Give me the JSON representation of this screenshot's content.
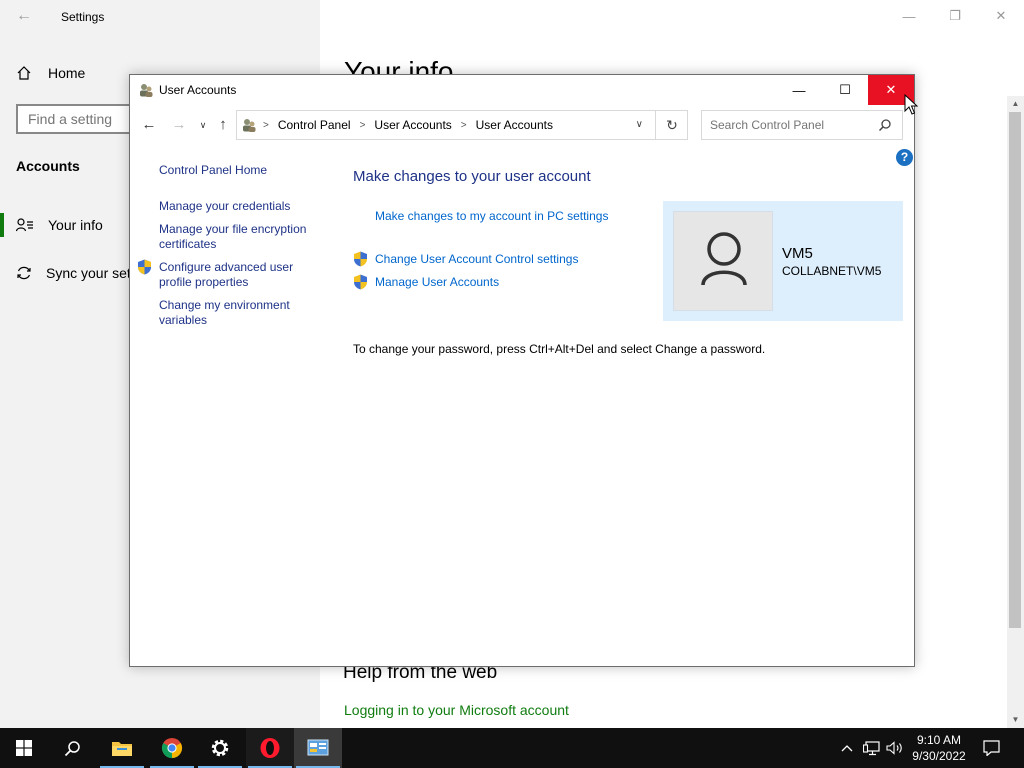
{
  "settings": {
    "title": "Settings",
    "home_label": "Home",
    "search_placeholder": "Find a setting",
    "section": "Accounts",
    "nav": [
      {
        "label": "Your info"
      },
      {
        "label": "Sync your set"
      }
    ],
    "page_heading": "Your info",
    "help_heading": "Help from the web",
    "help_link": "Logging in to your Microsoft account",
    "accent_color": "#107c10"
  },
  "user_accounts": {
    "title": "User Accounts",
    "breadcrumb": [
      "Control Panel",
      "User Accounts",
      "User Accounts"
    ],
    "search_placeholder": "Search Control Panel",
    "left_links": {
      "home": "Control Panel Home",
      "credentials": "Manage your credentials",
      "encryption_line1": "Manage your file encryption",
      "encryption_line2": "certificates",
      "profile_line1": "Configure advanced user",
      "profile_line2": "profile properties",
      "env_line1": "Change my environment",
      "env_line2": "variables"
    },
    "heading": "Make changes to your user account",
    "links": {
      "pc_settings": "Make changes to my account in PC settings",
      "uac": "Change User Account Control settings",
      "manage": "Manage User Accounts"
    },
    "password_note": "To change your password, press Ctrl+Alt+Del and select Change a password.",
    "account": {
      "name": "VM5",
      "domain": "COLLABNET\\VM5"
    },
    "close_color": "#e81123",
    "link_color": "#0066cc"
  },
  "taskbar": {
    "time": "9:10 AM",
    "date": "9/30/2022",
    "apps": [
      "start-icon",
      "search-icon",
      "file-explorer-icon",
      "chrome-icon",
      "settings-gear-icon",
      "opera-icon",
      "control-panel-icon"
    ]
  }
}
